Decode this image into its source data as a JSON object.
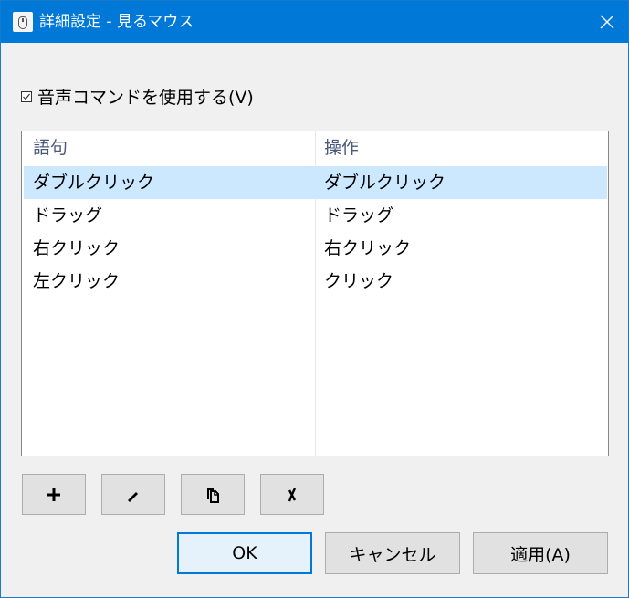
{
  "window": {
    "title": "詳細設定 - 見るマウス",
    "app_icon": "mouse-icon",
    "close_icon": "close-icon"
  },
  "voice_commands": {
    "checked": true,
    "label": "音声コマンドを使用する(V)"
  },
  "table": {
    "columns": [
      "語句",
      "操作"
    ],
    "rows": [
      {
        "phrase": "ダブルクリック",
        "action": "ダブルクリック",
        "selected": true
      },
      {
        "phrase": "ドラッグ",
        "action": "ドラッグ",
        "selected": false
      },
      {
        "phrase": "右クリック",
        "action": "右クリック",
        "selected": false
      },
      {
        "phrase": "左クリック",
        "action": "クリック",
        "selected": false
      }
    ]
  },
  "toolbar": {
    "add_icon": "plus-icon",
    "edit_icon": "pencil-icon",
    "copy_icon": "copy-icon",
    "delete_icon": "x-icon"
  },
  "buttons": {
    "ok": "OK",
    "cancel": "キャンセル",
    "apply": "適用(A)"
  },
  "colors": {
    "titlebar": "#0078d7",
    "selection": "#cce8ff",
    "window_bg": "#f0f0f0"
  }
}
